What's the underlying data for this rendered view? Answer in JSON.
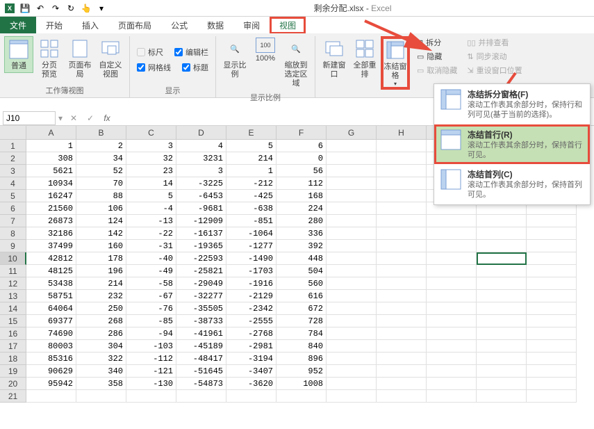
{
  "title": {
    "doc": "剩余分配.xlsx",
    "app": "Excel"
  },
  "tabs": {
    "file": "文件",
    "items": [
      "开始",
      "插入",
      "页面布局",
      "公式",
      "数据",
      "审阅",
      "视图"
    ],
    "active": "视图"
  },
  "ribbon": {
    "group_views": {
      "normal": "普通",
      "page_break": "分页\n预览",
      "page_layout": "页面布局",
      "custom": "自定义视图",
      "label": "工作簿视图"
    },
    "group_show": {
      "ruler": "标尺",
      "formula_bar": "编辑栏",
      "gridlines": "网格线",
      "headings": "标题",
      "label": "显示"
    },
    "group_zoom": {
      "zoom": "显示比例",
      "hundred": "100%",
      "to_selection": "缩放到\n选定区域",
      "label": "显示比例"
    },
    "group_window": {
      "new_window": "新建窗口",
      "arrange": "全部重排",
      "freeze": "冻结窗格",
      "split": "拆分",
      "hide": "隐藏",
      "unhide": "取消隐藏",
      "side_by_side": "并排查看",
      "sync_scroll": "同步滚动",
      "reset_pos": "重设窗口位置"
    }
  },
  "freeze_menu": {
    "item1": {
      "title": "冻结拆分窗格(F)",
      "desc": "滚动工作表其余部分时，保持行和列可见(基于当前的选择)。"
    },
    "item2": {
      "title": "冻结首行(R)",
      "desc": "滚动工作表其余部分时，保持首行可见。"
    },
    "item3": {
      "title": "冻结首列(C)",
      "desc": "滚动工作表其余部分时，保持首列可见。"
    }
  },
  "formula": {
    "cell_ref": "J10"
  },
  "chart_data": {
    "type": "table",
    "columns": [
      "A",
      "B",
      "C",
      "D",
      "E",
      "F",
      "G",
      "H"
    ],
    "rows": [
      [
        1,
        2,
        3,
        4,
        5,
        6,
        "",
        ""
      ],
      [
        308,
        34,
        32,
        3231,
        214,
        0,
        "",
        ""
      ],
      [
        5621,
        52,
        23,
        3,
        1,
        56,
        "",
        ""
      ],
      [
        10934,
        70,
        14,
        -3225,
        -212,
        112,
        "",
        ""
      ],
      [
        16247,
        88,
        5,
        -6453,
        -425,
        168,
        "",
        ""
      ],
      [
        21560,
        106,
        -4,
        -9681,
        -638,
        224,
        "",
        ""
      ],
      [
        26873,
        124,
        -13,
        -12909,
        -851,
        280,
        "",
        ""
      ],
      [
        32186,
        142,
        -22,
        -16137,
        -1064,
        336,
        "",
        ""
      ],
      [
        37499,
        160,
        -31,
        -19365,
        -1277,
        392,
        "",
        ""
      ],
      [
        42812,
        178,
        -40,
        -22593,
        -1490,
        448,
        "",
        ""
      ],
      [
        48125,
        196,
        -49,
        -25821,
        -1703,
        504,
        "",
        ""
      ],
      [
        53438,
        214,
        -58,
        -29049,
        -1916,
        560,
        "",
        ""
      ],
      [
        58751,
        232,
        -67,
        -32277,
        -2129,
        616,
        "",
        ""
      ],
      [
        64064,
        250,
        -76,
        -35505,
        -2342,
        672,
        "",
        ""
      ],
      [
        69377,
        268,
        -85,
        -38733,
        -2555,
        728,
        "",
        ""
      ],
      [
        74690,
        286,
        -94,
        -41961,
        -2768,
        784,
        "",
        ""
      ],
      [
        80003,
        304,
        -103,
        -45189,
        -2981,
        840,
        "",
        ""
      ],
      [
        85316,
        322,
        -112,
        -48417,
        -3194,
        896,
        "",
        ""
      ],
      [
        90629,
        340,
        -121,
        -51645,
        -3407,
        952,
        "",
        ""
      ],
      [
        95942,
        358,
        -130,
        -54873,
        -3620,
        1008,
        "",
        ""
      ]
    ]
  },
  "selected_cell": "J10"
}
